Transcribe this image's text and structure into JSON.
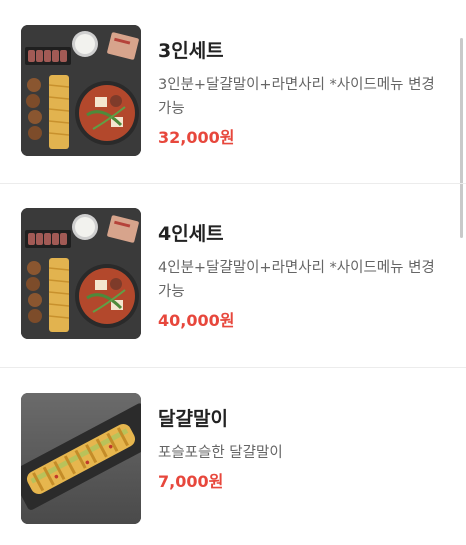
{
  "menu": {
    "items": [
      {
        "name": "3인세트",
        "description": "3인분+달걀말이+라면사리 *사이드메뉴 변경 가능",
        "price": "32,000원",
        "image_icon": "set-meal-photo"
      },
      {
        "name": "4인세트",
        "description": "4인분+달걀말이+라면사리 *사이드메뉴 변경 가능",
        "price": "40,000원",
        "image_icon": "set-meal-photo"
      },
      {
        "name": "달걀말이",
        "description": "포슬포슬한 달걀말이",
        "price": "7,000원",
        "image_icon": "rolled-omelette-photo"
      }
    ]
  },
  "colors": {
    "price": "#e7473c",
    "name": "#222222",
    "description": "#666666",
    "divider": "#ececec"
  }
}
